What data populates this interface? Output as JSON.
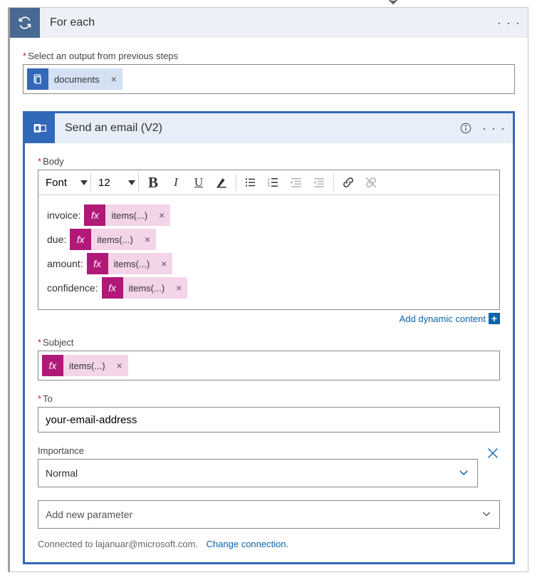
{
  "for_each": {
    "title": "For each",
    "select_label": "Select an output from previous steps",
    "token": {
      "label": "documents",
      "close": "×"
    }
  },
  "email": {
    "title": "Send an email (V2)",
    "body_label": "Body",
    "toolbar": {
      "font": "Font",
      "size": "12"
    },
    "body_lines": [
      {
        "prefix": "invoice:",
        "token": "items(...)"
      },
      {
        "prefix": "due:",
        "token": "items(...)"
      },
      {
        "prefix": "amount:",
        "token": "items(...)"
      },
      {
        "prefix": "confidence:",
        "token": "items(...)"
      }
    ],
    "add_dynamic": "Add dynamic content",
    "subject_label": "Subject",
    "subject_token": "items(...)",
    "to_label": "To",
    "to_value": "your-email-address",
    "importance_label": "Importance",
    "importance_value": "Normal",
    "add_param": "Add new parameter",
    "connected_to_prefix": "Connected to ",
    "connected_to_email": "lajanuar@microsoft.com.",
    "change_connection": "Change connection."
  },
  "glyphs": {
    "close": "×",
    "plus": "+",
    "fx": "fx"
  }
}
